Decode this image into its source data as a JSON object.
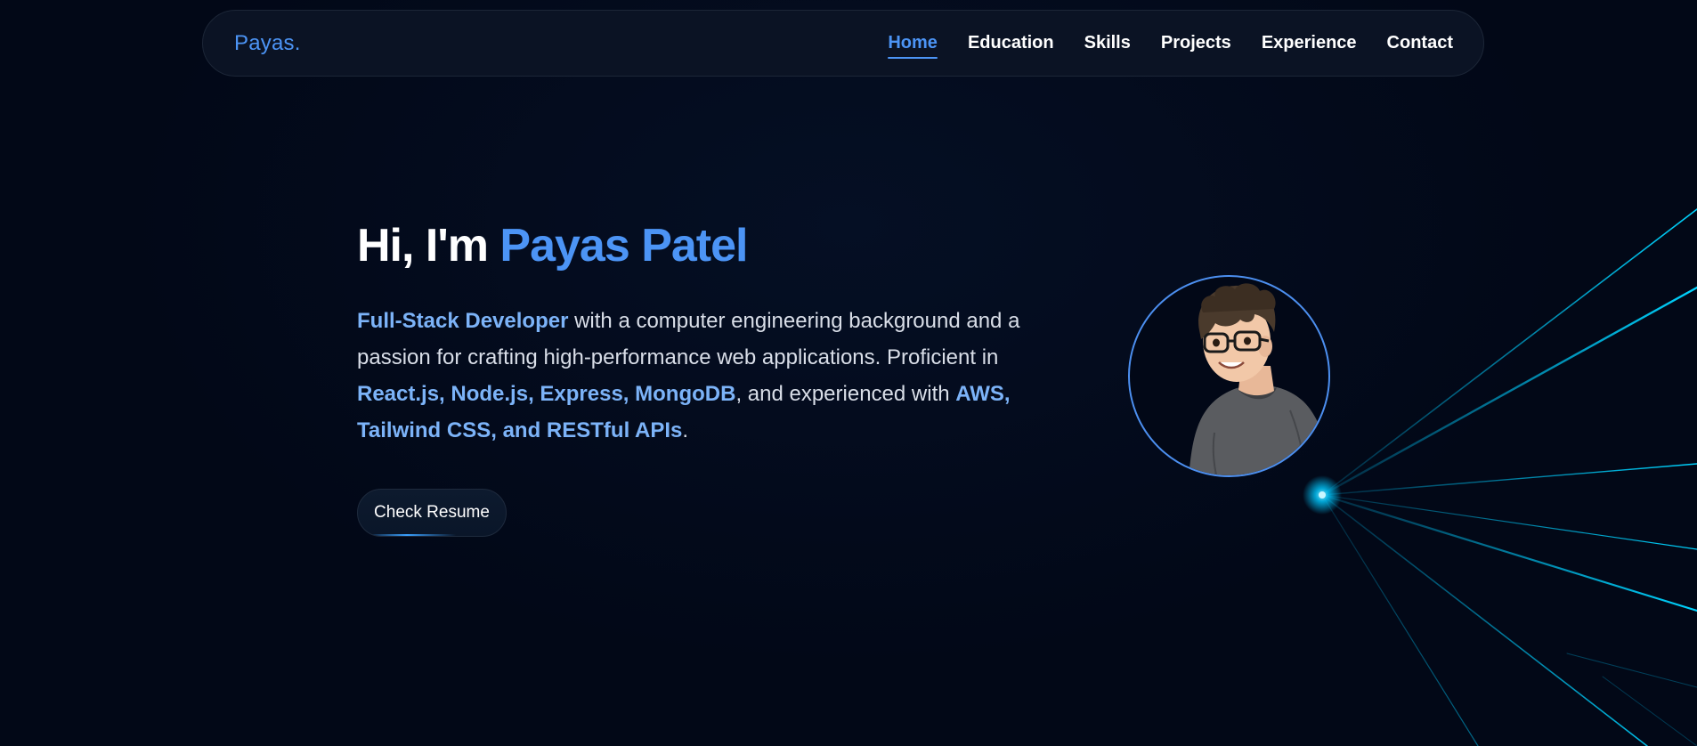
{
  "navbar": {
    "logo": "Payas.",
    "links": [
      {
        "label": "Home",
        "active": true
      },
      {
        "label": "Education",
        "active": false
      },
      {
        "label": "Skills",
        "active": false
      },
      {
        "label": "Projects",
        "active": false
      },
      {
        "label": "Experience",
        "active": false
      },
      {
        "label": "Contact",
        "active": false
      }
    ]
  },
  "hero": {
    "greeting": "Hi, I'm ",
    "name": "Payas Patel",
    "desc": {
      "role": "Full-Stack Developer",
      "text1": " with a computer engineering background and a passion for crafting high-performance web applications. Proficient in ",
      "stack": "React.js, Node.js, Express, MongoDB",
      "text2": ", and experienced with ",
      "tools": "AWS, Tailwind CSS, and RESTful APIs",
      "end": "."
    },
    "resume_button": "Check Resume"
  },
  "avatar": {
    "icon": "avatar-illustration-icon"
  },
  "colors": {
    "background": "#020817",
    "accent": "#4c94f5",
    "highlight": "#7cb3f8",
    "ray": "#00c8ff"
  }
}
